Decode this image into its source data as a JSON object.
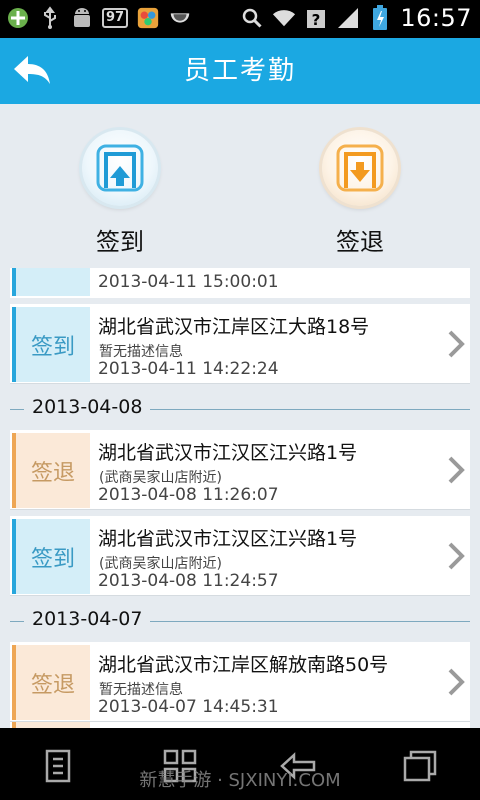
{
  "status_bar": {
    "battery_level": "97",
    "time": "16:57"
  },
  "header": {
    "title": "员工考勤"
  },
  "actions": {
    "check_in_label": "签到",
    "check_out_label": "签退"
  },
  "records": {
    "partial_top": {
      "time": "2013-04-11 15:00:01",
      "type": "in"
    },
    "groups": [
      {
        "date": "",
        "items": [
          {
            "type": "in",
            "tag": "签到",
            "address": "湖北省武汉市江岸区江大路18号",
            "description": "暂无描述信息",
            "time": "2013-04-11 14:22:24"
          }
        ]
      },
      {
        "date": "2013-04-08",
        "items": [
          {
            "type": "out",
            "tag": "签退",
            "address": "湖北省武汉市江汉区江兴路1号",
            "description": "(武商吴家山店附近)",
            "time": "2013-04-08 11:26:07"
          },
          {
            "type": "in",
            "tag": "签到",
            "address": "湖北省武汉市江汉区江兴路1号",
            "description": "(武商吴家山店附近)",
            "time": "2013-04-08 11:24:57"
          }
        ]
      },
      {
        "date": "2013-04-07",
        "items": [
          {
            "type": "out",
            "tag": "签退",
            "address": "湖北省武汉市江岸区解放南路50号",
            "description": "暂无描述信息",
            "time": "2013-04-07 14:45:31"
          }
        ]
      }
    ]
  },
  "watermark": "新慧手游 · SJXINYI.COM",
  "colors": {
    "header_bg": "#1ba8e2",
    "check_in_accent": "#27a6dc",
    "check_out_accent": "#eea654"
  }
}
